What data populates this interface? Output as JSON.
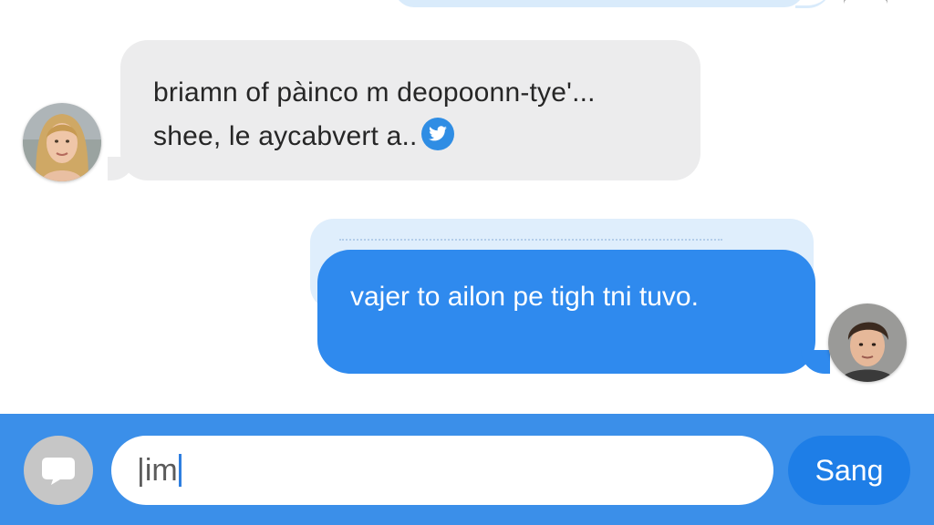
{
  "messages": {
    "incoming": {
      "line1": "briamn of pàinco m deopoonn-tye'...",
      "line2": "shee, le aycabvert a..",
      "icon": "twitter-bird-icon"
    },
    "outgoing": {
      "text": "vajer to ailon pe tigh tni tuvo."
    }
  },
  "composer": {
    "input_value": "|im",
    "send_label": "Sang",
    "chat_icon": "speech-bubble-icon"
  },
  "colors": {
    "outgoing_bubble": "#2f8aee",
    "incoming_bubble": "#ececed",
    "composer_bar": "#3b8fe9",
    "send_button": "#1e7ee7"
  }
}
